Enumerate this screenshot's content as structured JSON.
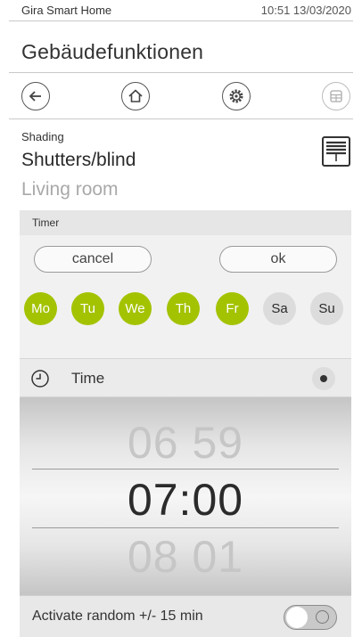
{
  "status": {
    "app_name": "Gira Smart Home",
    "datetime": "10:51 13/03/2020"
  },
  "page": {
    "title": "Gebäudefunktionen"
  },
  "nav": [
    "back-icon",
    "home-icon",
    "settings-icon",
    "grid-icon"
  ],
  "device": {
    "category": "Shading",
    "name": "Shutters/blind",
    "room": "Living room",
    "icon": "blind-icon"
  },
  "timer": {
    "header": "Timer",
    "cancel_label": "cancel",
    "ok_label": "ok",
    "days": [
      {
        "label": "Mo",
        "active": true
      },
      {
        "label": "Tu",
        "active": true
      },
      {
        "label": "We",
        "active": true
      },
      {
        "label": "Th",
        "active": true
      },
      {
        "label": "Fr",
        "active": true
      },
      {
        "label": "Sa",
        "active": false
      },
      {
        "label": "Su",
        "active": false
      }
    ],
    "active_day_color": "#a3c300",
    "time_label": "Time",
    "time_selected": true,
    "picker": {
      "prev": "06 59",
      "current": "07:00",
      "next": "08 01"
    },
    "random_label": "Activate random +/- 15 min",
    "random_enabled": false
  }
}
